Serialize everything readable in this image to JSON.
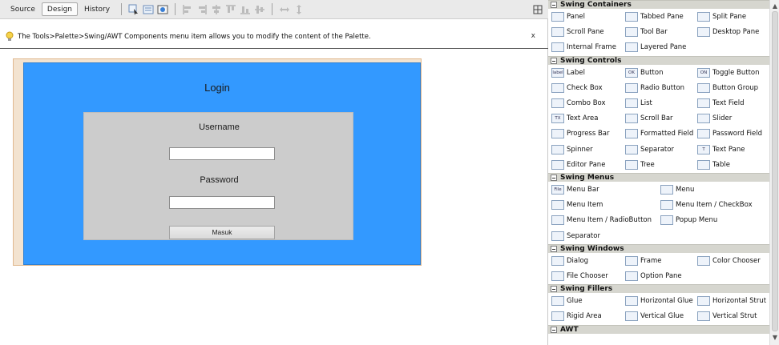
{
  "toolbar": {
    "tabs": [
      "Source",
      "Design",
      "History"
    ],
    "active_tab": "Design"
  },
  "infobar": {
    "message": "The Tools>Palette>Swing/AWT Components menu item allows you to modify the content of the Palette.",
    "close": "x"
  },
  "form": {
    "title": "Login",
    "username_label": "Username",
    "password_label": "Password",
    "button_label": "Masuk",
    "panel_color": "#3399ff",
    "inner_color": "#cccccc"
  },
  "palette": {
    "categories": [
      {
        "name": "Swing Containers",
        "items": [
          "Panel",
          "Tabbed Pane",
          "Split Pane",
          "Scroll Pane",
          "Tool Bar",
          "Desktop Pane",
          "Internal Frame",
          "Layered Pane"
        ]
      },
      {
        "name": "Swing Controls",
        "items": [
          "Label",
          "Button",
          "Toggle Button",
          "Check Box",
          "Radio Button",
          "Button Group",
          "Combo Box",
          "List",
          "Text Field",
          "Text Area",
          "Scroll Bar",
          "Slider",
          "Progress Bar",
          "Formatted Field",
          "Password Field",
          "Spinner",
          "Separator",
          "Text Pane",
          "Editor Pane",
          "Tree",
          "Table"
        ]
      },
      {
        "name": "Swing Menus",
        "items": [
          "Menu Bar",
          "Menu",
          "Menu Item",
          "Menu Item / CheckBox",
          "Menu Item / RadioButton",
          "Popup Menu",
          "Separator"
        ]
      },
      {
        "name": "Swing Windows",
        "items": [
          "Dialog",
          "Frame",
          "Color Chooser",
          "File Chooser",
          "Option Pane"
        ]
      },
      {
        "name": "Swing Fillers",
        "items": [
          "Glue",
          "Horizontal Glue",
          "Horizontal Strut",
          "Rigid Area",
          "Vertical Glue",
          "Vertical Strut"
        ]
      },
      {
        "name": "AWT",
        "items": []
      }
    ],
    "icon_texts": {
      "Label": "label",
      "Button": "OK",
      "Toggle Button": "ON",
      "Text Area": "TX",
      "Text Pane": "T",
      "Menu Bar": "File"
    }
  }
}
